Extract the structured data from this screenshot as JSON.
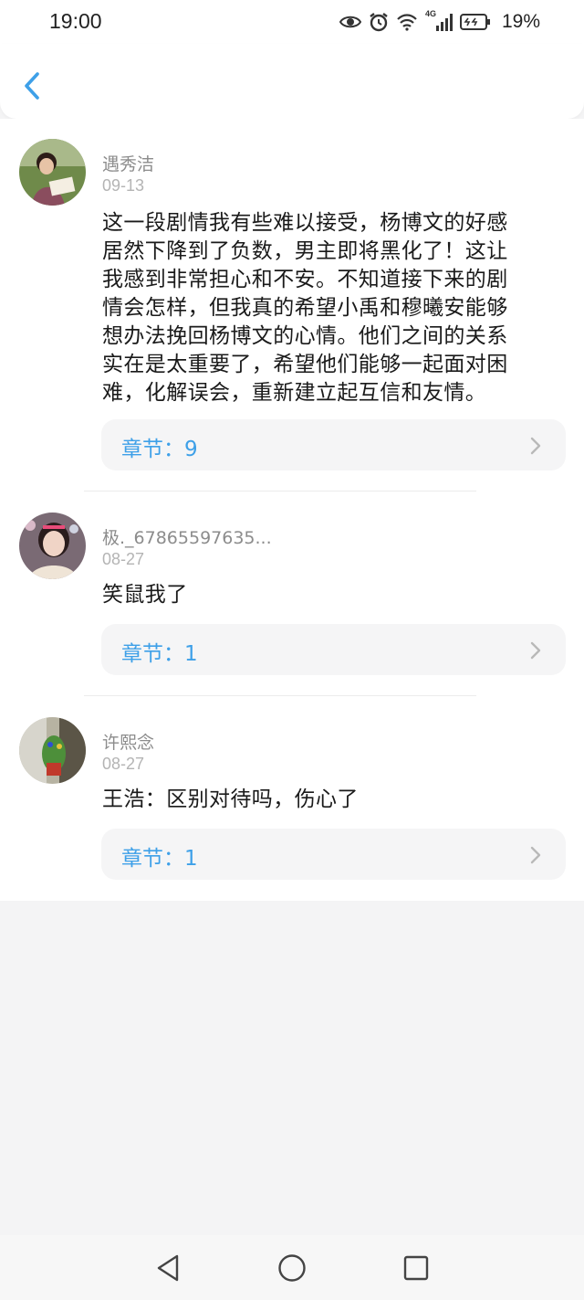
{
  "status_bar": {
    "time": "19:00",
    "network": "4G",
    "battery": "19%",
    "icons": [
      "eye-icon",
      "alarm-icon",
      "wifi-icon",
      "signal-icon",
      "battery-icon"
    ]
  },
  "header": {
    "back_icon": "chevron-left-icon"
  },
  "comments": [
    {
      "username": "遇秀洁",
      "date": "09-13",
      "text_lines": [
        "这一段剧情我有些难以接受，杨博文的好感",
        "居然下降到了负数，男主即将黑化了！这让",
        "我感到非常担心和不安。不知道接下来的剧",
        "情会怎样，但我真的希望小禹和穆曦安能够",
        "想办法挽回杨博文的心情。他们之间的关系",
        "实在是太重要了，希望他们能够一起面对困",
        "难，化解误会，重新建立起互信和友情。"
      ],
      "chapter": "章节：9"
    },
    {
      "username": "极._67865597635...",
      "date": "08-27",
      "text_lines": [
        "笑鼠我了"
      ],
      "chapter": "章节：1"
    },
    {
      "username": "许熙念",
      "date": "08-27",
      "text_lines": [
        "王浩：区别对待吗，伤心了"
      ],
      "chapter": "章节：1"
    }
  ],
  "navbar": {
    "icons": [
      "back-triangle-icon",
      "home-circle-icon",
      "recents-square-icon"
    ]
  },
  "colors": {
    "accent": "#3ea0e8",
    "page_bg": "#f4f4f5",
    "card_bg": "#f5f5f6"
  }
}
